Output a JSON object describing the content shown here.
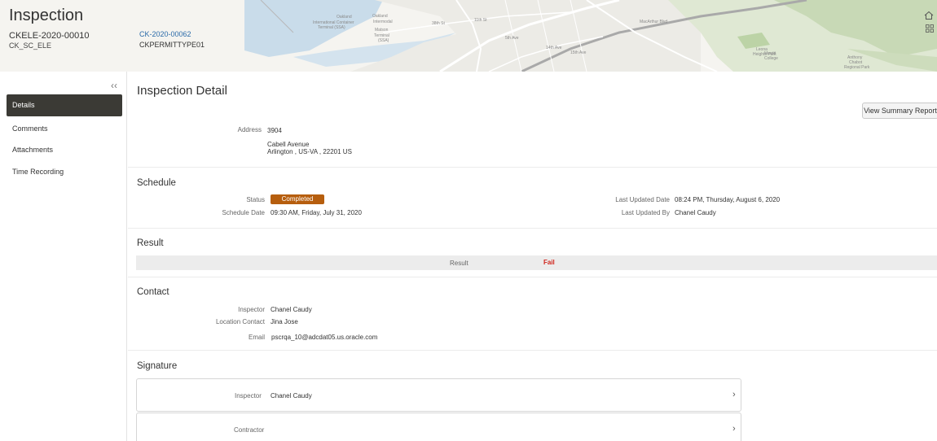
{
  "header": {
    "title": "Inspection",
    "inspection_id": "CKELE-2020-00010",
    "inspection_type": "CK_SC_ELE",
    "case_link": "CK-2020-00062",
    "permit_type": "CKPERMITTYPE01",
    "map_labels": [
      "Oakland",
      "International Container",
      "Terminal (SSA)",
      "Oakland",
      "Intermodal",
      "Matson",
      "Terminal",
      "(SSA)",
      "38th St",
      "11th St",
      "5th Ave",
      "14th Ave",
      "15th Ave",
      "Leona",
      "Heights Park",
      "Merritt",
      "College",
      "Anthony",
      "Chabot",
      "Regional Park",
      "MacArthur Blvd"
    ],
    "icons": [
      "home-icon",
      "app-grid-icon"
    ]
  },
  "sidebar": {
    "collapse_label": "‹‹",
    "items": [
      {
        "label": "Details",
        "active": true
      },
      {
        "label": "Comments",
        "active": false
      },
      {
        "label": "Attachments",
        "active": false
      },
      {
        "label": "Time Recording",
        "active": false
      }
    ]
  },
  "main": {
    "title": "Inspection Detail",
    "summary_button": "View Summary Report",
    "address": {
      "label": "Address",
      "line1": "3904",
      "line2": "Cabell Avenue",
      "line3": "Arlington , US-VA , 22201 US"
    },
    "schedule": {
      "title": "Schedule",
      "status_label": "Status",
      "status_value": "Completed",
      "status_color": "#b65e0e",
      "schedule_date_label": "Schedule Date",
      "schedule_date_value": "09:30 AM, Friday, July 31, 2020",
      "last_updated_date_label": "Last Updated Date",
      "last_updated_date_value": "08:24 PM, Thursday, August 6, 2020",
      "last_updated_by_label": "Last Updated By",
      "last_updated_by_value": "Chanel Caudy"
    },
    "result": {
      "title": "Result",
      "label": "Result",
      "value": "Fail",
      "value_color": "#d0241b"
    },
    "contact": {
      "title": "Contact",
      "inspector_label": "Inspector",
      "inspector_value": "Chanel Caudy",
      "location_contact_label": "Location Contact",
      "location_contact_value": "Jina Jose",
      "email_label": "Email",
      "email_value": "pscrqa_10@adcdat05.us.oracle.com"
    },
    "signature": {
      "title": "Signature",
      "cards": [
        {
          "label": "Inspector",
          "value": "Chanel Caudy"
        },
        {
          "label": "Contractor",
          "value": ""
        }
      ],
      "chevron": "›"
    }
  },
  "colors": {
    "nav_active_bg": "#3b3a35",
    "link": "#2a6aa8"
  }
}
